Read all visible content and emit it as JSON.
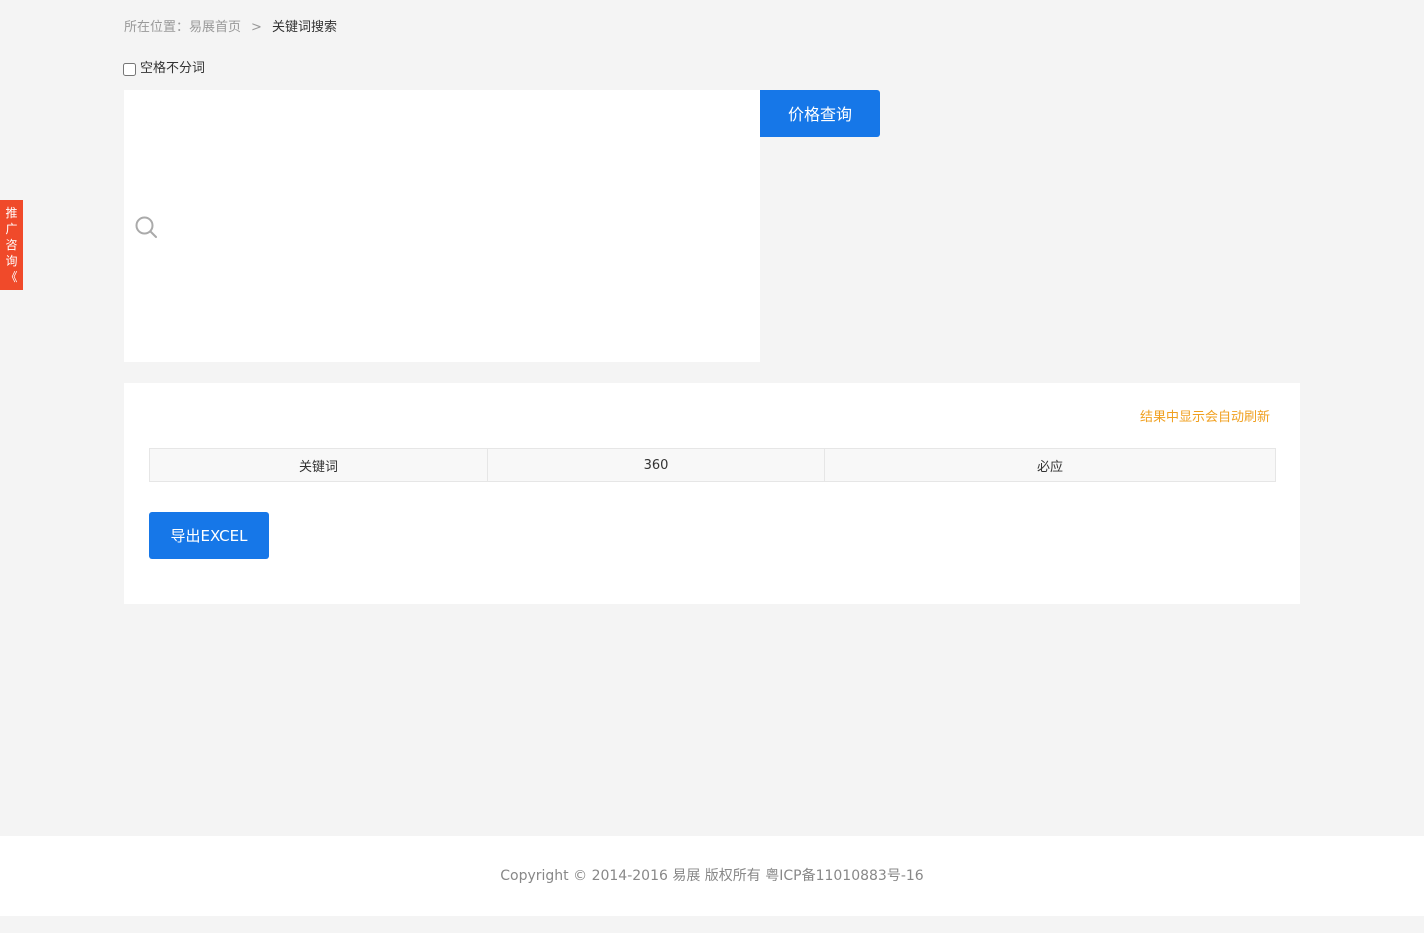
{
  "breadcrumb": {
    "prefix": "所在位置：",
    "home": "易展首页",
    "separator": ">",
    "current": "关键词搜索"
  },
  "options": {
    "no_split_label": "空格不分词",
    "no_split_checked": false
  },
  "search": {
    "icon": "search-icon",
    "value": "",
    "submit_label": "价格查询"
  },
  "results": {
    "refresh_note": "结果中显示会自动刷新",
    "columns": [
      "关键词",
      "360",
      "必应"
    ],
    "rows": [],
    "export_label": "导出EXCEL"
  },
  "side_tab": {
    "chars": [
      "推",
      "广",
      "咨",
      "询",
      "《"
    ]
  },
  "footer": {
    "copyright": "Copyright © 2014-2016 易展 版权所有 粤ICP备11010883号-16"
  },
  "colors": {
    "primary": "#1677e8",
    "side_tab": "#f04a2a",
    "note": "#f0a020",
    "background": "#f4f4f4"
  }
}
